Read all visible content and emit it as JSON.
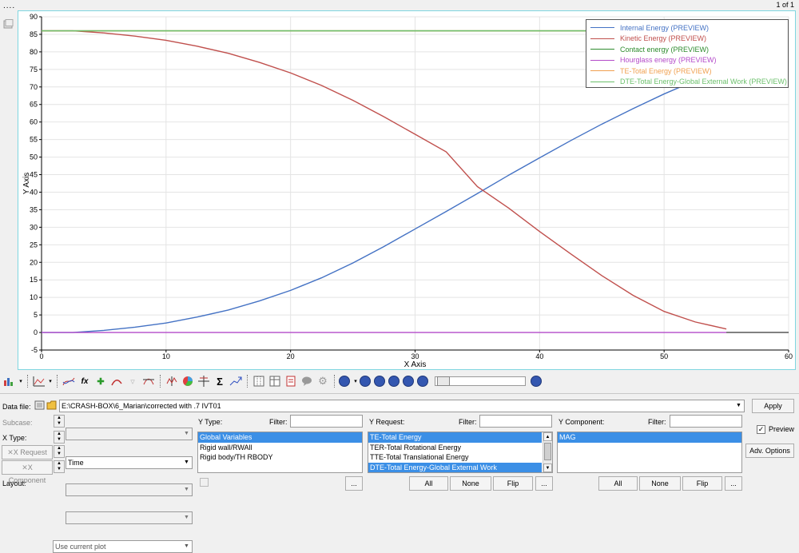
{
  "window": {
    "page_indicator": "1 of 1",
    "menu_dots": "...."
  },
  "chart_data": {
    "type": "line",
    "xlabel": "X Axis",
    "ylabel": "Y Axis",
    "xlim": [
      0,
      60
    ],
    "ylim": [
      -5,
      90
    ],
    "xticks": [
      "0",
      "10",
      "20",
      "30",
      "40",
      "50",
      "60"
    ],
    "yticks": [
      "-5",
      "0",
      "5",
      "10",
      "15",
      "20",
      "25",
      "30",
      "35",
      "40",
      "45",
      "50",
      "55",
      "60",
      "65",
      "70",
      "75",
      "80",
      "85",
      "90"
    ],
    "grid": true,
    "legend_position": "top-right",
    "series": [
      {
        "name": "Internal Energy (PREVIEW)",
        "color": "#4472c4",
        "x": [
          0,
          2.5,
          5,
          7.5,
          10,
          12.5,
          15,
          17.5,
          20,
          22.5,
          25,
          27.5,
          30,
          32.5,
          35,
          37.5,
          40,
          42.5,
          45,
          47.5,
          50,
          52.5,
          55
        ],
        "y": [
          0,
          0,
          0.6,
          1.5,
          2.7,
          4.4,
          6.4,
          9.0,
          12.0,
          15.6,
          19.8,
          24.5,
          29.5,
          34.5,
          39.6,
          44.8,
          49.8,
          54.7,
          59.4,
          63.8,
          68.0,
          71.8,
          75.0
        ]
      },
      {
        "name": "Kinetic Energy (PREVIEW)",
        "color": "#c0504d",
        "x": [
          0,
          2.5,
          5,
          7.5,
          10,
          12.5,
          15,
          17.5,
          20,
          22.5,
          25,
          27.5,
          30,
          32.5,
          35,
          37.5,
          40,
          42.5,
          45,
          47.5,
          50,
          52.5,
          55
        ],
        "y": [
          86,
          86,
          85.4,
          84.5,
          83.3,
          81.6,
          79.6,
          77.0,
          74.0,
          70.4,
          66.2,
          61.5,
          56.5,
          51.5,
          41.6,
          35.5,
          28.8,
          22.4,
          16.2,
          10.6,
          6.0,
          3.0,
          1.0
        ]
      },
      {
        "name": "Contact energy (PREVIEW)",
        "color": "#2e8b2e",
        "x": [
          0,
          55
        ],
        "y": [
          86,
          86
        ]
      },
      {
        "name": "Hourglass energy (PREVIEW)",
        "color": "#b44bc9",
        "x": [
          0,
          55
        ],
        "y": [
          0,
          0
        ]
      },
      {
        "name": "TE-Total Energy (PREVIEW)",
        "color": "#f0a050",
        "x": [
          0,
          55
        ],
        "y": [
          86,
          86
        ]
      },
      {
        "name": "DTE-Total Energy-Global External Work (PREVIEW)",
        "color": "#6cc06c",
        "x": [
          0,
          55
        ],
        "y": [
          86,
          86
        ]
      }
    ]
  },
  "toolbar": {
    "icons": [
      "plot-type-icon",
      "curve-icon",
      "define-curve-icon",
      "math-icon",
      "add-curve-icon",
      "delete-curve-icon",
      "filter-icon",
      "axis-icon",
      "color-icon",
      "cross-icon",
      "sum-icon",
      "fit-icon",
      "grid-icon",
      "table-icon",
      "report-icon",
      "note-icon",
      "settings-icon",
      "animation-icon",
      "first-frame-icon",
      "prev-frame-icon",
      "play-icon",
      "next-frame-icon",
      "last-frame-icon",
      "options-icon"
    ]
  },
  "panel": {
    "data_file_label": "Data file:",
    "data_file_value": "E:\\CRASH-BOX\\6_Marian\\corrected with .7 IVT01",
    "apply_button": "Apply",
    "subcase_label": "Subcase:",
    "xtype_label": "X Type:",
    "xtype_value": "Time",
    "xrequest_label": "X Request",
    "xcomponent_label": "X Component",
    "layout_label": "Layout:",
    "layout_value": "Use current plot",
    "ytype_label": "Y Type:",
    "ytype_filter_label": "Filter:",
    "ytype_items": [
      "Global Variables",
      "Rigid wall/RWAll",
      "Rigid body/TH RBODY"
    ],
    "yrequest_label": "Y Request:",
    "yrequest_filter_label": "Filter:",
    "yrequest_items": [
      "TE-Total Energy",
      "TER-Total Rotational Energy",
      "TTE-Total Translational Energy",
      "DTE-Total Energy-Global External Work"
    ],
    "ycomponent_label": "Y Component:",
    "ycomponent_filter_label": "Filter:",
    "ycomponent_items": [
      "MAG"
    ],
    "all_button": "All",
    "none_button": "None",
    "flip_button": "Flip",
    "ellipsis_button": "...",
    "preview_label": "Preview",
    "preview_checked": "✓",
    "adv_options_button": "Adv. Options"
  }
}
